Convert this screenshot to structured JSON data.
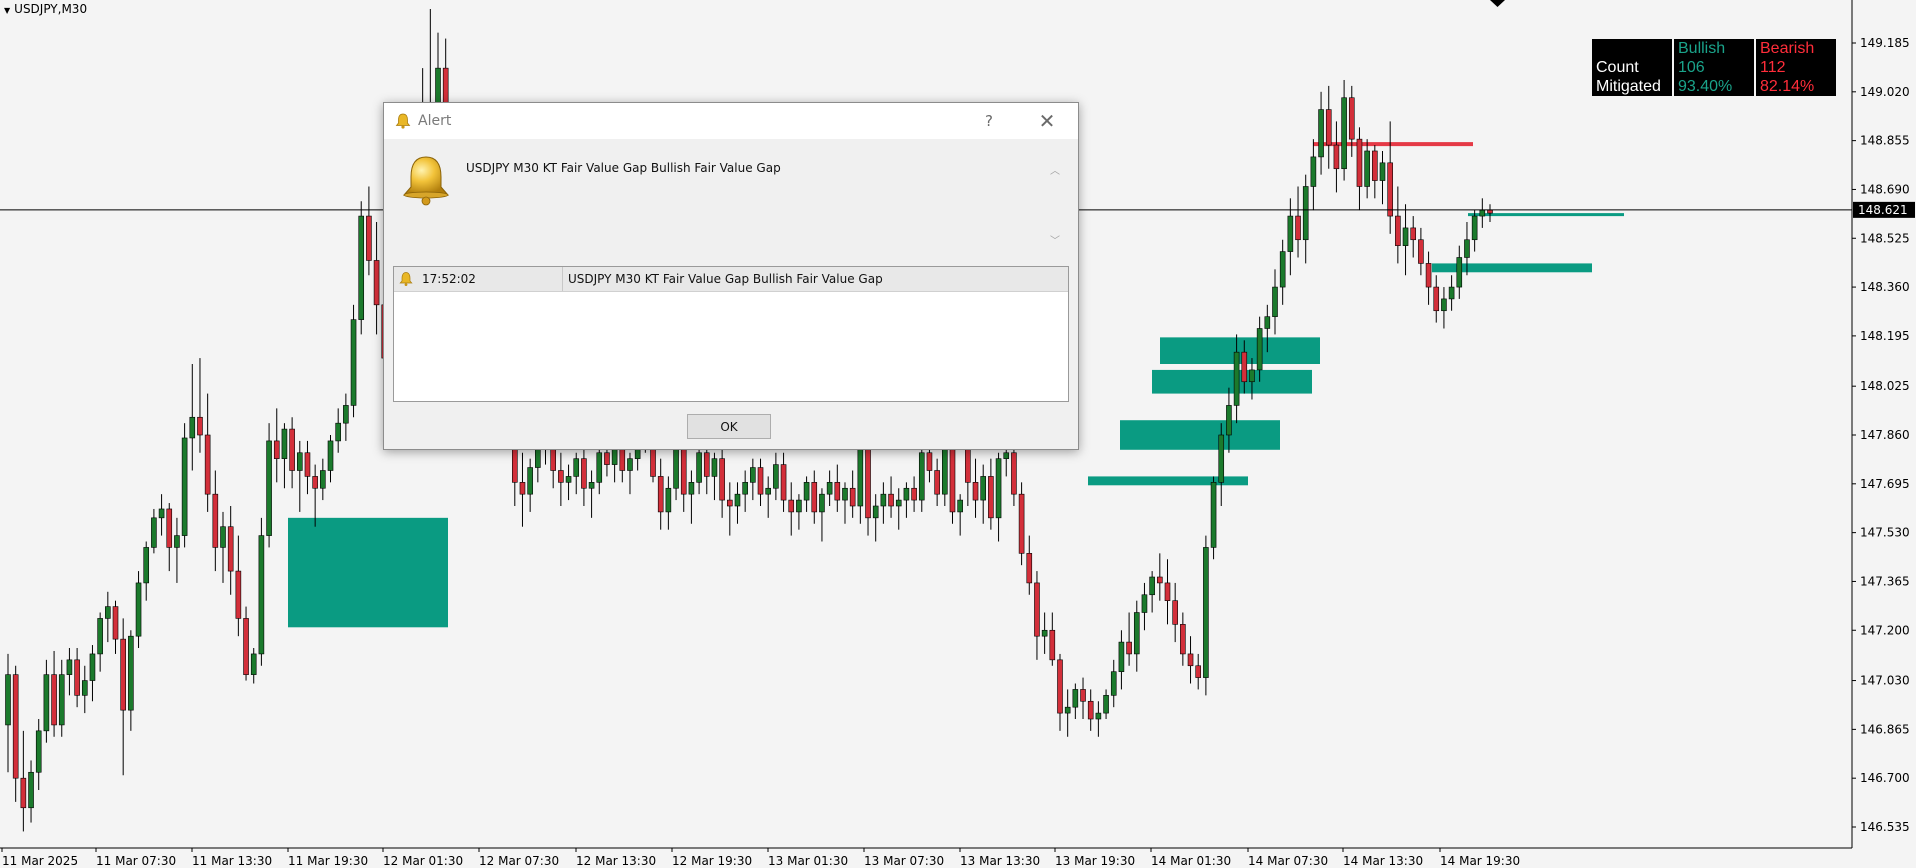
{
  "chart": {
    "symbol": "USDJPY,M30",
    "current_price": "148.621",
    "colors": {
      "background": "#f4f4f4",
      "bull_candle": "#1b7a2c",
      "bear_candle": "#d32f3a",
      "bullish_fvg": "#0a9b82",
      "bearish_fvg": "#e53946",
      "price_line": "#000000",
      "price_tag_bg": "#000000",
      "price_tag_text": "#ffffff"
    }
  },
  "price_axis": {
    "labels": [
      "149.185",
      "149.020",
      "148.855",
      "148.690",
      "148.525",
      "148.360",
      "148.195",
      "148.025",
      "147.860",
      "147.695",
      "147.530",
      "147.365",
      "147.200",
      "147.030",
      "146.865",
      "146.700",
      "146.535"
    ]
  },
  "time_axis": {
    "labels": [
      "11 Mar 2025",
      "11 Mar 07:30",
      "11 Mar 13:30",
      "11 Mar 19:30",
      "12 Mar 01:30",
      "12 Mar 07:30",
      "12 Mar 13:30",
      "12 Mar 19:30",
      "13 Mar 01:30",
      "13 Mar 07:30",
      "13 Mar 13:30",
      "13 Mar 19:30",
      "14 Mar 01:30",
      "14 Mar 07:30",
      "14 Mar 13:30",
      "14 Mar 19:30"
    ]
  },
  "stats_panel": {
    "header": [
      "",
      "Bullish",
      "Bearish"
    ],
    "rows": [
      {
        "label": "Count",
        "bullish": "106",
        "bearish": "112"
      },
      {
        "label": "Mitigated",
        "bullish": "93.40%",
        "bearish": "82.14%"
      }
    ],
    "bullish_color": "#1aa38a",
    "bearish_color": "#ff2d3a"
  },
  "alert": {
    "title": "Alert",
    "help": "?",
    "close": "✕",
    "message": "USDJPY M30 KT Fair Value Gap Bullish Fair Value Gap",
    "history": [
      {
        "time": "17:52:02",
        "text": "USDJPY M30 KT Fair Value Gap Bullish Fair Value Gap"
      }
    ],
    "ok_label": "OK"
  },
  "chart_data": {
    "type": "candlestick",
    "title": "",
    "ylim": [
      146.45,
      149.3
    ],
    "y_ticks": [
      149.185,
      149.02,
      148.855,
      148.69,
      148.525,
      148.36,
      148.195,
      148.025,
      147.86,
      147.695,
      147.53,
      147.365,
      147.2,
      147.03,
      146.865,
      146.7,
      146.535
    ],
    "x_ticks": [
      "11 Mar 2025",
      "11 Mar 07:30",
      "11 Mar 13:30",
      "11 Mar 19:30",
      "12 Mar 01:30",
      "12 Mar 07:30",
      "12 Mar 13:30",
      "12 Mar 19:30",
      "13 Mar 01:30",
      "13 Mar 07:30",
      "13 Mar 13:30",
      "13 Mar 19:30",
      "14 Mar 01:30",
      "14 Mar 07:30",
      "14 Mar 13:30",
      "14 Mar 19:30"
    ],
    "current_price": 148.621,
    "candles": [
      [
        146.88,
        147.12,
        146.72,
        147.05
      ],
      [
        147.05,
        147.08,
        146.62,
        146.7
      ],
      [
        146.7,
        146.86,
        146.52,
        146.6
      ],
      [
        146.6,
        146.76,
        146.55,
        146.72
      ],
      [
        146.72,
        146.9,
        146.66,
        146.86
      ],
      [
        146.86,
        147.1,
        146.82,
        147.05
      ],
      [
        147.05,
        147.13,
        146.84,
        146.88
      ],
      [
        146.88,
        147.1,
        146.84,
        147.05
      ],
      [
        147.05,
        147.14,
        146.98,
        147.1
      ],
      [
        147.1,
        147.14,
        146.94,
        146.98
      ],
      [
        146.98,
        147.08,
        146.92,
        147.03
      ],
      [
        147.03,
        147.15,
        146.96,
        147.12
      ],
      [
        147.12,
        147.26,
        147.06,
        147.24
      ],
      [
        147.24,
        147.33,
        147.16,
        147.28
      ],
      [
        147.28,
        147.3,
        147.12,
        147.17
      ],
      [
        147.17,
        147.24,
        146.71,
        146.93
      ],
      [
        146.93,
        147.2,
        146.86,
        147.18
      ],
      [
        147.18,
        147.4,
        147.14,
        147.36
      ],
      [
        147.36,
        147.5,
        147.3,
        147.48
      ],
      [
        147.48,
        147.61,
        147.46,
        147.58
      ],
      [
        147.58,
        147.66,
        147.52,
        147.61
      ],
      [
        147.61,
        147.63,
        147.4,
        147.48
      ],
      [
        147.48,
        147.58,
        147.36,
        147.52
      ],
      [
        147.52,
        147.9,
        147.48,
        147.85
      ],
      [
        147.85,
        148.1,
        147.74,
        147.92
      ],
      [
        147.92,
        148.12,
        147.8,
        147.86
      ],
      [
        147.86,
        148.0,
        147.6,
        147.66
      ],
      [
        147.66,
        147.74,
        147.4,
        147.48
      ],
      [
        147.48,
        147.6,
        147.36,
        147.55
      ],
      [
        147.55,
        147.62,
        147.32,
        147.4
      ],
      [
        147.4,
        147.52,
        147.18,
        147.24
      ],
      [
        147.24,
        147.28,
        147.03,
        147.05
      ],
      [
        147.05,
        147.14,
        147.02,
        147.12
      ],
      [
        147.12,
        147.58,
        147.08,
        147.52
      ],
      [
        147.52,
        147.9,
        147.48,
        147.84
      ],
      [
        147.84,
        147.95,
        147.7,
        147.78
      ],
      [
        147.78,
        147.9,
        147.68,
        147.88
      ],
      [
        147.88,
        147.92,
        147.68,
        147.74
      ],
      [
        147.74,
        147.84,
        147.6,
        147.8
      ],
      [
        147.8,
        147.84,
        147.66,
        147.72
      ],
      [
        147.72,
        147.76,
        147.55,
        147.68
      ],
      [
        147.68,
        147.78,
        147.64,
        147.74
      ],
      [
        147.74,
        147.86,
        147.7,
        147.84
      ],
      [
        147.84,
        147.95,
        147.8,
        147.9
      ],
      [
        147.9,
        148.0,
        147.84,
        147.96
      ],
      [
        147.96,
        148.3,
        147.92,
        148.25
      ],
      [
        148.25,
        148.65,
        148.2,
        148.6
      ],
      [
        148.6,
        148.7,
        148.4,
        148.45
      ],
      [
        148.45,
        148.58,
        148.2,
        148.3
      ],
      [
        148.3,
        148.42,
        148.08,
        148.12
      ],
      [
        148.12,
        148.25,
        147.98,
        148.05
      ],
      [
        148.05,
        148.2,
        147.9,
        148.15
      ],
      [
        148.15,
        148.3,
        148.05,
        148.22
      ],
      [
        148.22,
        148.4,
        148.12,
        148.3
      ],
      [
        148.3,
        149.1,
        148.26,
        148.7
      ],
      [
        148.7,
        149.3,
        148.5,
        148.95
      ],
      [
        148.95,
        149.22,
        148.8,
        149.1
      ],
      [
        149.1,
        149.2,
        148.78,
        148.86
      ],
      [
        148.86,
        148.95,
        148.6,
        148.7
      ],
      [
        148.7,
        148.85,
        148.4,
        148.52
      ],
      [
        148.52,
        148.6,
        148.2,
        148.3
      ],
      [
        148.3,
        148.4,
        148.06,
        148.14
      ],
      [
        148.14,
        148.2,
        147.92,
        148.02
      ],
      [
        148.02,
        148.12,
        147.84,
        147.94
      ],
      [
        147.94,
        148.08,
        147.86,
        148.04
      ],
      [
        148.04,
        148.12,
        147.82,
        147.88
      ],
      [
        147.88,
        147.96,
        147.62,
        147.7
      ],
      [
        147.7,
        147.8,
        147.55,
        147.66
      ],
      [
        147.66,
        147.78,
        147.6,
        147.75
      ],
      [
        147.75,
        147.86,
        147.7,
        147.82
      ],
      [
        147.82,
        147.9,
        147.76,
        147.86
      ],
      [
        147.86,
        147.9,
        147.68,
        147.74
      ],
      [
        147.74,
        147.8,
        147.62,
        147.7
      ],
      [
        147.7,
        147.76,
        147.64,
        147.72
      ],
      [
        147.72,
        147.8,
        147.66,
        147.78
      ],
      [
        147.78,
        147.82,
        147.62,
        147.68
      ],
      [
        147.68,
        147.74,
        147.58,
        147.7
      ],
      [
        147.7,
        147.82,
        147.66,
        147.8
      ],
      [
        147.8,
        147.86,
        147.72,
        147.76
      ],
      [
        147.76,
        147.84,
        147.7,
        147.82
      ],
      [
        147.82,
        147.85,
        147.7,
        147.74
      ],
      [
        147.74,
        147.8,
        147.66,
        147.78
      ],
      [
        147.78,
        147.86,
        147.74,
        147.84
      ],
      [
        147.84,
        147.9,
        147.8,
        147.86
      ],
      [
        147.86,
        147.88,
        147.7,
        147.72
      ],
      [
        147.72,
        147.78,
        147.54,
        147.6
      ],
      [
        147.6,
        147.72,
        147.54,
        147.68
      ],
      [
        147.68,
        147.86,
        147.64,
        147.82
      ],
      [
        147.82,
        147.88,
        147.6,
        147.66
      ],
      [
        147.66,
        147.74,
        147.56,
        147.7
      ],
      [
        147.7,
        147.84,
        147.66,
        147.8
      ],
      [
        147.8,
        147.86,
        147.66,
        147.72
      ],
      [
        147.72,
        147.8,
        147.64,
        147.78
      ],
      [
        147.78,
        147.82,
        147.58,
        147.64
      ],
      [
        147.64,
        147.7,
        147.52,
        147.62
      ],
      [
        147.62,
        147.7,
        147.56,
        147.66
      ],
      [
        147.66,
        147.74,
        147.6,
        147.7
      ],
      [
        147.7,
        147.78,
        147.64,
        147.75
      ],
      [
        147.75,
        147.78,
        147.62,
        147.66
      ],
      [
        147.66,
        147.72,
        147.58,
        147.68
      ],
      [
        147.68,
        147.8,
        147.64,
        147.76
      ],
      [
        147.76,
        147.8,
        147.6,
        147.64
      ],
      [
        147.64,
        147.7,
        147.52,
        147.6
      ],
      [
        147.6,
        147.66,
        147.54,
        147.64
      ],
      [
        147.64,
        147.72,
        147.6,
        147.7
      ],
      [
        147.7,
        147.74,
        147.56,
        147.6
      ],
      [
        147.6,
        147.68,
        147.5,
        147.66
      ],
      [
        147.66,
        147.74,
        147.62,
        147.7
      ],
      [
        147.7,
        147.76,
        147.6,
        147.64
      ],
      [
        147.64,
        147.7,
        147.56,
        147.68
      ],
      [
        147.68,
        147.74,
        147.58,
        147.62
      ],
      [
        147.62,
        147.9,
        147.56,
        147.82
      ],
      [
        147.82,
        147.86,
        147.52,
        147.58
      ],
      [
        147.58,
        147.66,
        147.5,
        147.62
      ],
      [
        147.62,
        147.7,
        147.56,
        147.66
      ],
      [
        147.66,
        147.72,
        147.58,
        147.62
      ],
      [
        147.62,
        147.68,
        147.54,
        147.64
      ],
      [
        147.64,
        147.7,
        147.58,
        147.68
      ],
      [
        147.68,
        147.72,
        147.6,
        147.64
      ],
      [
        147.64,
        147.84,
        147.6,
        147.8
      ],
      [
        147.8,
        147.86,
        147.7,
        147.74
      ],
      [
        147.74,
        147.78,
        147.62,
        147.66
      ],
      [
        147.66,
        147.86,
        147.62,
        147.82
      ],
      [
        147.82,
        147.88,
        147.56,
        147.6
      ],
      [
        147.6,
        147.66,
        147.52,
        147.64
      ],
      [
        147.82,
        147.88,
        147.62,
        147.7
      ],
      [
        147.7,
        147.78,
        147.58,
        147.64
      ],
      [
        147.64,
        147.76,
        147.56,
        147.72
      ],
      [
        147.72,
        147.78,
        147.54,
        147.58
      ],
      [
        147.58,
        147.8,
        147.5,
        147.78
      ],
      [
        147.78,
        147.86,
        147.72,
        147.8
      ],
      [
        147.8,
        147.84,
        147.62,
        147.66
      ],
      [
        147.66,
        147.7,
        147.42,
        147.46
      ],
      [
        147.46,
        147.52,
        147.32,
        147.36
      ],
      [
        147.36,
        147.4,
        147.1,
        147.18
      ],
      [
        147.18,
        147.26,
        147.12,
        147.2
      ],
      [
        147.2,
        147.26,
        147.08,
        147.1
      ],
      [
        147.1,
        147.12,
        146.86,
        146.92
      ],
      [
        146.92,
        147.0,
        146.84,
        146.94
      ],
      [
        146.94,
        147.02,
        146.9,
        147.0
      ],
      [
        147.0,
        147.04,
        146.9,
        146.96
      ],
      [
        146.96,
        147.0,
        146.86,
        146.9
      ],
      [
        146.9,
        146.96,
        146.84,
        146.92
      ],
      [
        146.92,
        147.0,
        146.9,
        146.98
      ],
      [
        146.98,
        147.1,
        146.94,
        147.06
      ],
      [
        147.06,
        147.2,
        147.0,
        147.16
      ],
      [
        147.16,
        147.26,
        147.08,
        147.12
      ],
      [
        147.12,
        147.3,
        147.06,
        147.26
      ],
      [
        147.26,
        147.36,
        147.2,
        147.32
      ],
      [
        147.32,
        147.4,
        147.26,
        147.38
      ],
      [
        147.38,
        147.46,
        147.3,
        147.36
      ],
      [
        147.36,
        147.44,
        147.22,
        147.3
      ],
      [
        147.3,
        147.36,
        147.16,
        147.22
      ],
      [
        147.22,
        147.26,
        147.08,
        147.12
      ],
      [
        147.12,
        147.18,
        147.02,
        147.08
      ],
      [
        147.08,
        147.12,
        147.0,
        147.04
      ],
      [
        147.04,
        147.52,
        146.98,
        147.48
      ],
      [
        147.48,
        147.72,
        147.44,
        147.7
      ],
      [
        147.7,
        147.9,
        147.62,
        147.86
      ],
      [
        147.86,
        148.02,
        147.8,
        147.96
      ],
      [
        147.96,
        148.2,
        147.9,
        148.14
      ],
      [
        148.14,
        148.18,
        148.0,
        148.04
      ],
      [
        148.04,
        148.12,
        147.98,
        148.08
      ],
      [
        148.08,
        148.26,
        148.04,
        148.22
      ],
      [
        148.22,
        148.3,
        148.14,
        148.26
      ],
      [
        148.26,
        148.42,
        148.2,
        148.36
      ],
      [
        148.36,
        148.52,
        148.3,
        148.48
      ],
      [
        148.48,
        148.66,
        148.4,
        148.6
      ],
      [
        148.6,
        148.7,
        148.46,
        148.52
      ],
      [
        148.52,
        148.74,
        148.44,
        148.7
      ],
      [
        148.7,
        148.86,
        148.62,
        148.8
      ],
      [
        148.8,
        149.02,
        148.74,
        148.96
      ],
      [
        148.96,
        149.04,
        148.76,
        148.84
      ],
      [
        148.84,
        148.92,
        148.68,
        148.76
      ],
      [
        148.76,
        149.06,
        148.72,
        149.0
      ],
      [
        149.0,
        149.04,
        148.8,
        148.86
      ],
      [
        148.86,
        148.9,
        148.62,
        148.7
      ],
      [
        148.7,
        148.86,
        148.66,
        148.82
      ],
      [
        148.82,
        148.84,
        148.66,
        148.72
      ],
      [
        148.72,
        148.82,
        148.64,
        148.78
      ],
      [
        148.78,
        148.92,
        148.54,
        148.6
      ],
      [
        148.6,
        148.7,
        148.44,
        148.5
      ],
      [
        148.5,
        148.64,
        148.4,
        148.56
      ],
      [
        148.56,
        148.6,
        148.46,
        148.52
      ],
      [
        148.52,
        148.56,
        148.4,
        148.44
      ],
      [
        148.44,
        148.48,
        148.3,
        148.36
      ],
      [
        148.36,
        148.4,
        148.24,
        148.28
      ],
      [
        148.28,
        148.36,
        148.22,
        148.32
      ],
      [
        148.32,
        148.4,
        148.28,
        148.36
      ],
      [
        148.36,
        148.5,
        148.32,
        148.46
      ],
      [
        148.46,
        148.58,
        148.4,
        148.52
      ],
      [
        148.52,
        148.62,
        148.48,
        148.6
      ],
      [
        148.6,
        148.66,
        148.56,
        148.62
      ],
      [
        148.62,
        148.64,
        148.58,
        148.61
      ]
    ],
    "bullish_fvgs": [
      {
        "x_from": "11 Mar 19:30",
        "x_to": "12 Mar 01:30",
        "price_top": 147.58,
        "price_bottom": 147.21
      },
      {
        "x_from": "13 Mar 19:30",
        "x_to": "14 Mar 07:30",
        "price_top": 148.19,
        "price_bottom": 148.1
      },
      {
        "x_from": "14 Mar 01:30",
        "x_to": "14 Mar 07:30",
        "price_top": 148.08,
        "price_bottom": 148.0
      },
      {
        "x_from": "13 Mar 19:30",
        "x_to": "14 Mar 07:30",
        "price_top": 147.91,
        "price_bottom": 147.81
      },
      {
        "x_from": "13 Mar 19:30",
        "x_to": "14 Mar 01:30",
        "price_top": 147.72,
        "price_bottom": 147.69
      },
      {
        "x_from": "14 Mar 13:30",
        "x_to": "14 Mar 19:30",
        "price_top": 148.44,
        "price_bottom": 148.41
      },
      {
        "x_from": "14 Mar 19:30",
        "x_to": "14 Mar 19:30",
        "price_top": 148.61,
        "price_bottom": 148.6
      }
    ],
    "bearish_fvgs": [
      {
        "x_from": "14 Mar 07:30",
        "x_to": "14 Mar 13:30",
        "price_top": 148.85,
        "price_bottom": 148.84
      }
    ]
  }
}
